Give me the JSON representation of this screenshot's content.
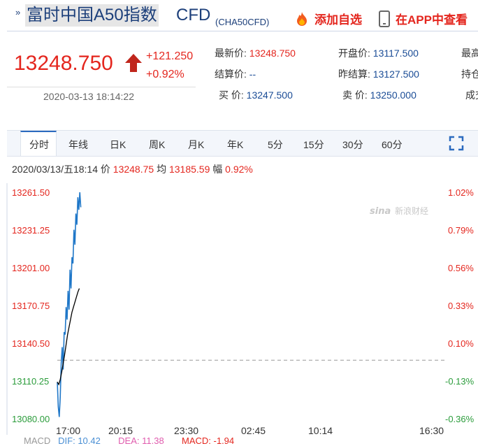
{
  "header": {
    "chevron": "»",
    "title": "富时中国A50指数",
    "title_suffix": "CFD",
    "symbol": "(CHA50CFD)",
    "fav_label": "添加自选",
    "app_label": "在APP中查看"
  },
  "quote": {
    "price": "13248.750",
    "change": "+121.250",
    "change_pct": "+0.92%",
    "datetime": "2020-03-13 18:14:22"
  },
  "stats": {
    "latest_label": "最新价:",
    "latest": "13248.750",
    "open_label": "开盘价:",
    "open": "13117.500",
    "high_label": "最高",
    "settle_label": "结算价:",
    "settle": "--",
    "prev_label": "昨结算:",
    "prev": "13127.500",
    "hold_label": "持仓",
    "bid_label": "买  价:",
    "bid": "13247.500",
    "ask_label": "卖  价:",
    "ask": "13250.000",
    "vol_label": "成交"
  },
  "tabs": [
    "分时",
    "年线",
    "日K",
    "周K",
    "月K",
    "年K",
    "5分",
    "15分",
    "30分",
    "60分"
  ],
  "info_line": {
    "date": "2020/03/13/五18:14",
    "price_label": "价",
    "price": "13248.75",
    "avg_label": "均",
    "avg": "13185.59",
    "pct_label": "幅",
    "pct": "0.92%"
  },
  "watermark": "新浪财经",
  "chart_data": {
    "type": "line",
    "y_left_ticks": [
      "13261.50",
      "13231.25",
      "13201.00",
      "13170.75",
      "13140.50",
      "13110.25",
      "13080.00"
    ],
    "y_right_ticks": [
      "1.02%",
      "0.79%",
      "0.56%",
      "0.33%",
      "0.10%",
      "-0.13%",
      "-0.36%"
    ],
    "x_ticks": [
      "17:00",
      "20:15",
      "23:30",
      "02:45",
      "10:14",
      "16:30"
    ],
    "ylim": [
      13080.0,
      13261.5
    ],
    "reference": 13127.5,
    "series": [
      {
        "name": "价",
        "color": "#1f77c8",
        "values": [
          13110,
          13090,
          13082,
          13098,
          13125,
          13138,
          13120,
          13150,
          13148,
          13170,
          13160,
          13183,
          13168,
          13200,
          13185,
          13210,
          13205,
          13232,
          13220,
          13245,
          13236,
          13258,
          13248,
          13262,
          13250
        ]
      },
      {
        "name": "均",
        "color": "#000000",
        "values": [
          13110,
          13108,
          13112,
          13118,
          13125,
          13132,
          13140,
          13148,
          13154,
          13160,
          13166,
          13170,
          13174,
          13178,
          13182,
          13185
        ]
      }
    ]
  },
  "macd": {
    "title": "MACD",
    "dif_label": "DIF:",
    "dif": "10.42",
    "dea_label": "DEA:",
    "dea": "11.38",
    "macd_label": "MACD:",
    "macd": "-1.94"
  },
  "colors": {
    "up": "#e4261e",
    "down": "#2b9c3b",
    "accent": "#1c3f7a"
  }
}
